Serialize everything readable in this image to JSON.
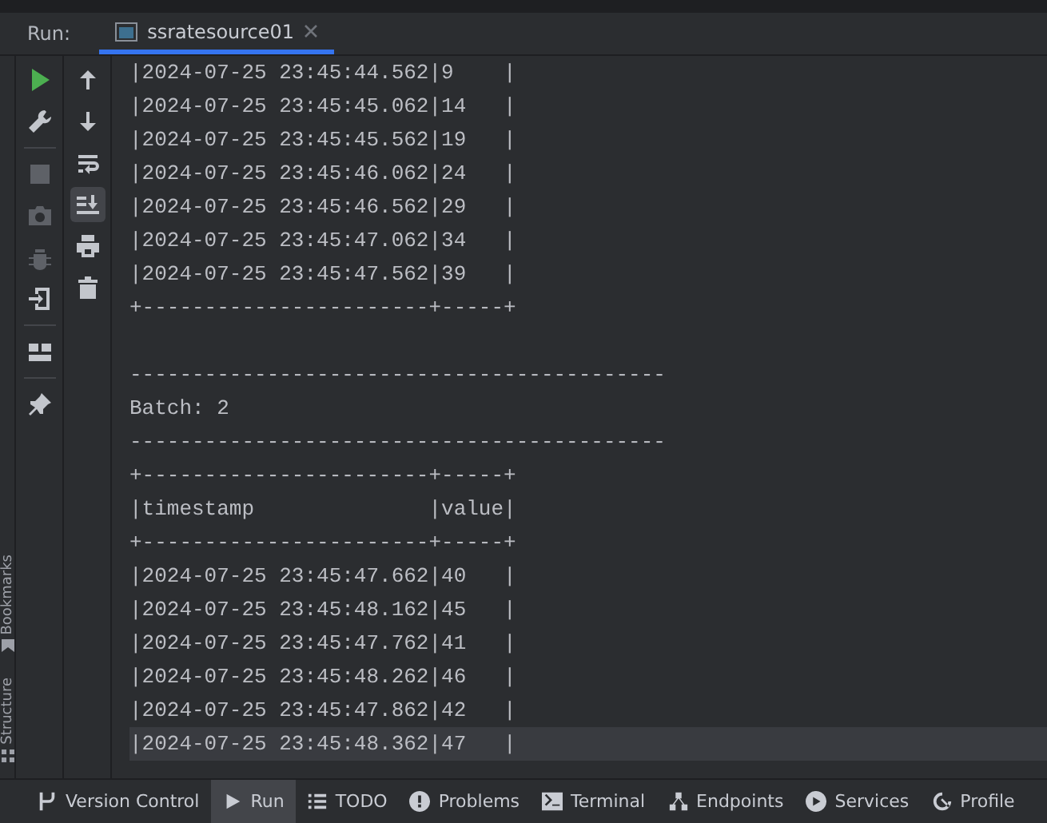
{
  "run_panel": {
    "label": "Run:",
    "tab": {
      "title": "ssratesource01",
      "selected": true
    }
  },
  "side_strip": [
    {
      "label": "Bookmarks",
      "kind": "bookmark"
    },
    {
      "label": "Structure",
      "kind": "structure"
    }
  ],
  "toolbar_primary": [
    {
      "kind": "run",
      "disabled": false
    },
    {
      "kind": "wrench",
      "disabled": false
    },
    {
      "kind": "stop",
      "disabled": true
    },
    {
      "kind": "camera",
      "disabled": true
    },
    {
      "kind": "bug",
      "disabled": true
    },
    {
      "kind": "exit",
      "disabled": false
    },
    {
      "kind": "layout",
      "disabled": false
    },
    {
      "kind": "pin",
      "disabled": false
    }
  ],
  "toolbar_secondary": [
    {
      "kind": "up",
      "selected": false
    },
    {
      "kind": "down",
      "selected": false
    },
    {
      "kind": "wrap",
      "selected": false
    },
    {
      "kind": "scroll-end",
      "selected": true
    },
    {
      "kind": "print",
      "selected": false
    },
    {
      "kind": "delete",
      "selected": false
    }
  ],
  "console_lines": [
    {
      "text": "|2024-07-25 23:45:44.562|9    |",
      "selected": false
    },
    {
      "text": "|2024-07-25 23:45:45.062|14   |",
      "selected": false
    },
    {
      "text": "|2024-07-25 23:45:45.562|19   |",
      "selected": false
    },
    {
      "text": "|2024-07-25 23:45:46.062|24   |",
      "selected": false
    },
    {
      "text": "|2024-07-25 23:45:46.562|29   |",
      "selected": false
    },
    {
      "text": "|2024-07-25 23:45:47.062|34   |",
      "selected": false
    },
    {
      "text": "|2024-07-25 23:45:47.562|39   |",
      "selected": false
    },
    {
      "text": "+-----------------------+-----+",
      "selected": false
    },
    {
      "selected": false
    },
    {
      "text": "-------------------------------------------",
      "selected": false
    },
    {
      "text": "Batch: 2",
      "selected": false
    },
    {
      "text": "-------------------------------------------",
      "selected": false
    },
    {
      "text": "+-----------------------+-----+",
      "selected": false
    },
    {
      "text": "|timestamp              |value|",
      "selected": false
    },
    {
      "text": "+-----------------------+-----+",
      "selected": false
    },
    {
      "text": "|2024-07-25 23:45:47.662|40   |",
      "selected": false
    },
    {
      "text": "|2024-07-25 23:45:48.162|45   |",
      "selected": false
    },
    {
      "text": "|2024-07-25 23:45:47.762|41   |",
      "selected": false
    },
    {
      "text": "|2024-07-25 23:45:48.262|46   |",
      "selected": false
    },
    {
      "text": "|2024-07-25 23:45:47.862|42   |",
      "selected": false
    },
    {
      "text": "|2024-07-25 23:45:48.362|47   |",
      "selected": true
    }
  ],
  "tool_windows": [
    {
      "label": "Version Control",
      "kind": "vcs",
      "selected": false
    },
    {
      "label": "Run",
      "kind": "run",
      "selected": true
    },
    {
      "label": "TODO",
      "kind": "list",
      "selected": false
    },
    {
      "label": "Problems",
      "kind": "problems",
      "selected": false
    },
    {
      "label": "Terminal",
      "kind": "terminal",
      "selected": false
    },
    {
      "label": "Endpoints",
      "kind": "endpoints",
      "selected": false
    },
    {
      "label": "Services",
      "kind": "services",
      "selected": false
    },
    {
      "label": "Profile",
      "kind": "profiler",
      "selected": false
    }
  ]
}
